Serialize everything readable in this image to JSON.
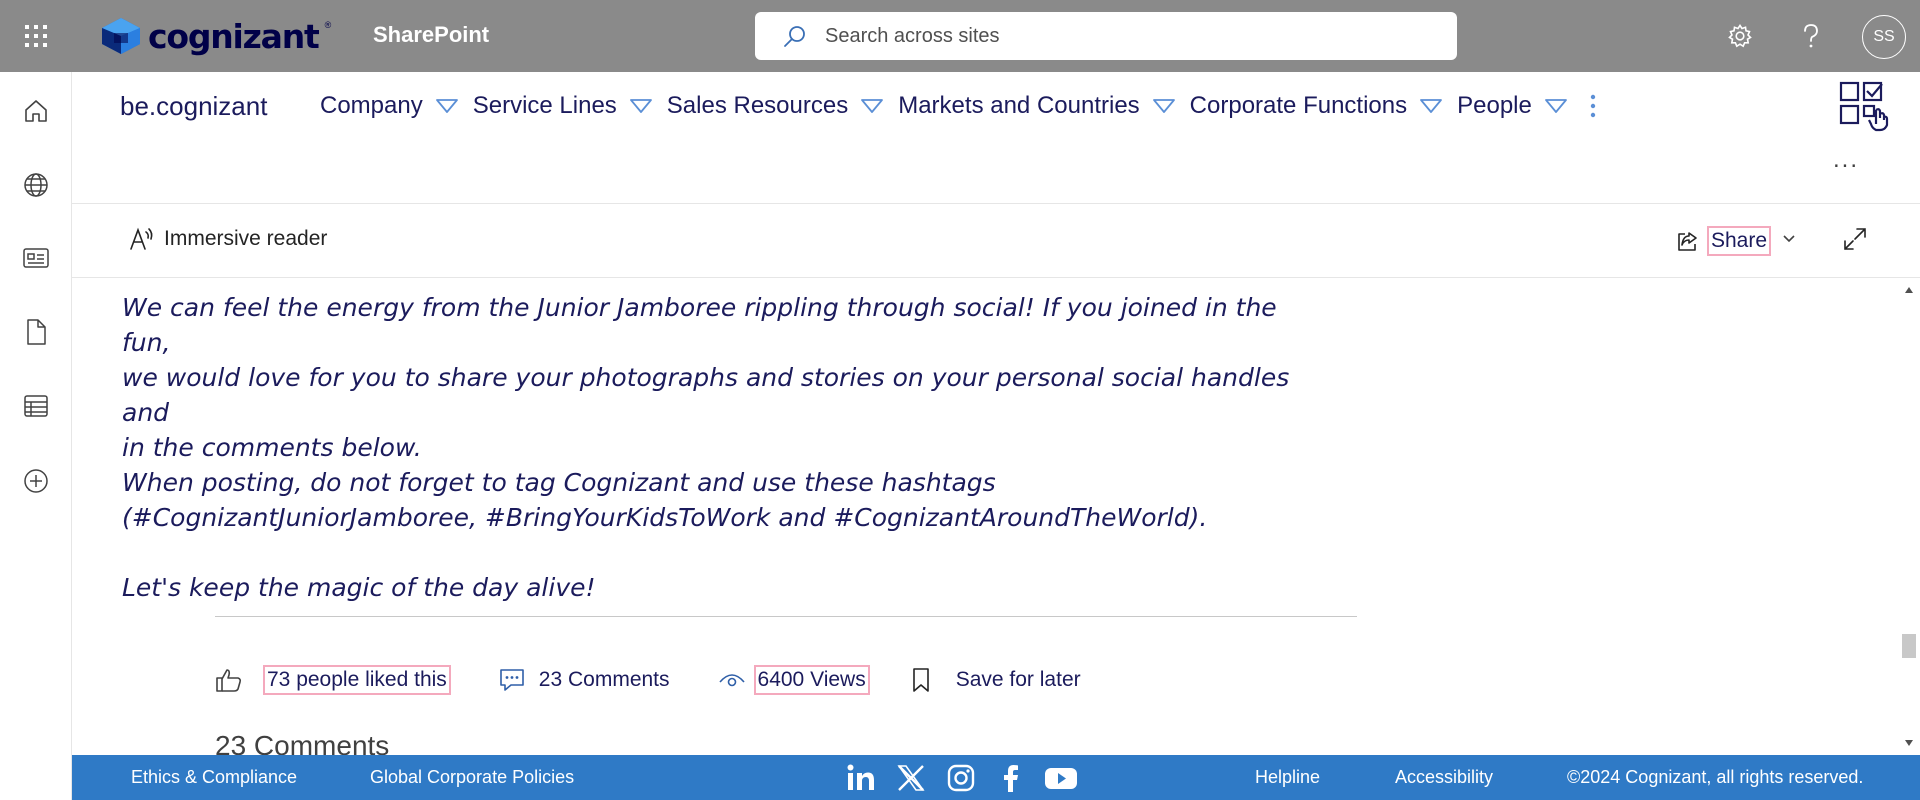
{
  "suite": {
    "brand": "cognizant",
    "brand_tm": "®",
    "app_name": "SharePoint",
    "search_placeholder": "Search across sites",
    "avatar_initials": "SS"
  },
  "site": {
    "title": "be.cognizant",
    "nav": [
      {
        "label": "Company"
      },
      {
        "label": "Service Lines"
      },
      {
        "label": "Sales Resources"
      },
      {
        "label": "Markets and Countries"
      },
      {
        "label": "Corporate Functions"
      },
      {
        "label": "People"
      }
    ],
    "more": "...",
    "page_more": "..."
  },
  "command_bar": {
    "immersive_reader": "Immersive reader",
    "share": "Share"
  },
  "article": {
    "paragraph_1": "We can feel the energy from the Junior Jamboree rippling through social! If you joined in the fun,\nwe would love for you to share your photographs and stories on your personal social handles and\nin the comments below.\nWhen posting, do not forget to tag Cognizant and use these hashtags\n(#CognizantJuniorJamboree, #BringYourKidsToWork and #CognizantAroundTheWorld).",
    "paragraph_2": "Let's keep the magic of the day alive!"
  },
  "engagement": {
    "likes": "73 people liked this",
    "comments": "23 Comments",
    "views": "6400 Views",
    "save": "Save for later",
    "comments_heading": "23 Comments"
  },
  "footer": {
    "ethics": "Ethics & Compliance",
    "policies": "Global Corporate Policies",
    "helpline": "Helpline",
    "accessibility": "Accessibility",
    "copyright": "©2024 Cognizant, all rights reserved.",
    "social": [
      "linkedin-icon",
      "x-icon",
      "instagram-icon",
      "facebook-icon",
      "youtube-icon"
    ]
  },
  "colors": {
    "suite_bar": "#8a8a8a",
    "brand_navy": "#000048",
    "text_navy": "#1b1b5c",
    "nav_chevron": "#5b8fd6",
    "footer": "#2f7ac6",
    "highlight_box": "#f4a9bd"
  }
}
